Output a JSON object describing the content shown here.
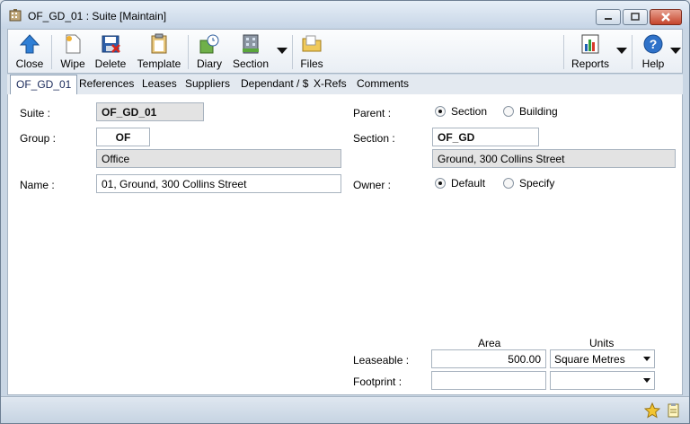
{
  "window": {
    "title": "OF_GD_01 : Suite [Maintain]",
    "icon": "building-icon",
    "controls": {
      "minimize": "minimize-icon",
      "maximize": "maximize-icon",
      "close": "close-icon"
    }
  },
  "toolbar": {
    "close": "Close",
    "wipe": "Wipe",
    "delete": "Delete",
    "template": "Template",
    "diary": "Diary",
    "section": "Section",
    "files": "Files",
    "reports": "Reports",
    "help": "Help"
  },
  "tabs": [
    "OF_GD_01",
    "References",
    "Leases",
    "Suppliers",
    "Dependant / $",
    "X-Refs",
    "Comments"
  ],
  "form": {
    "suite_label": "Suite :",
    "suite_value": "OF_GD_01",
    "group_label": "Group :",
    "group_code": "OF",
    "group_name": "Office",
    "name_label": "Name :",
    "name_value": "01, Ground, 300 Collins Street",
    "parent_label": "Parent :",
    "parent_option_section": "Section",
    "parent_option_building": "Building",
    "parent_selected": "Section",
    "section_label": "Section :",
    "section_code": "OF_GD",
    "section_name": "Ground, 300 Collins Street",
    "owner_label": "Owner :",
    "owner_option_default": "Default",
    "owner_option_specify": "Specify",
    "owner_selected": "Default"
  },
  "area": {
    "area_header": "Area",
    "units_header": "Units",
    "leaseable_label": "Leaseable :",
    "leaseable_area": "500.00",
    "leaseable_units": "Square Metres",
    "footprint_label": "Footprint :",
    "footprint_area": "",
    "footprint_units": ""
  },
  "colors": {
    "accent": "#1e5fb4",
    "panel": "#ffffff",
    "readonly": "#e3e3e3"
  }
}
